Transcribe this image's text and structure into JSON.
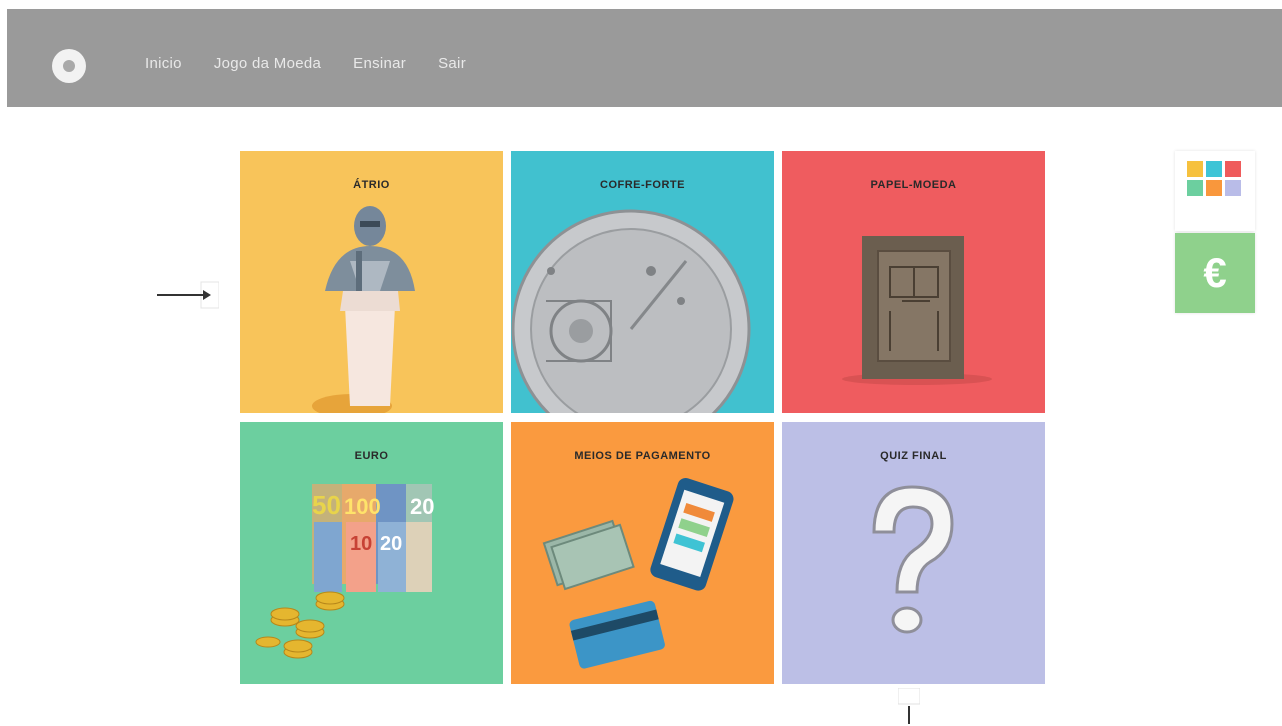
{
  "nav": {
    "items": [
      {
        "label": "Inicio"
      },
      {
        "label": "Jogo da Moeda"
      },
      {
        "label": "Ensinar"
      },
      {
        "label": "Sair"
      }
    ]
  },
  "tiles": [
    {
      "title": "ÁTRIO",
      "color": "#f8c45a",
      "icon": "statue-bust-icon"
    },
    {
      "title": "COFRE-FORTE",
      "color": "#41c1cf",
      "icon": "vault-door-icon"
    },
    {
      "title": "PAPEL-MOEDA",
      "color": "#ef5c5f",
      "icon": "banknote-plate-icon"
    },
    {
      "title": "EURO",
      "color": "#6ccf9f",
      "icon": "euro-banknotes-coins-icon"
    },
    {
      "title": "MEIOS DE PAGAMENTO",
      "color": "#fa9a3f",
      "icon": "payment-methods-icon"
    },
    {
      "title": "QUIZ FINAL",
      "color": "#bcbfe6",
      "icon": "question-mark-icon"
    }
  ],
  "side": {
    "grid_icon_colors": [
      "#f6c13e",
      "#3ec4d6",
      "#ef5b5b",
      "#6ccf9f",
      "#f9973c",
      "#b9bce8"
    ],
    "euro_button_color": "#8fd18c",
    "euro_symbol": "€"
  },
  "banknote_labels": [
    "50",
    "100",
    "20",
    "10",
    "20"
  ]
}
